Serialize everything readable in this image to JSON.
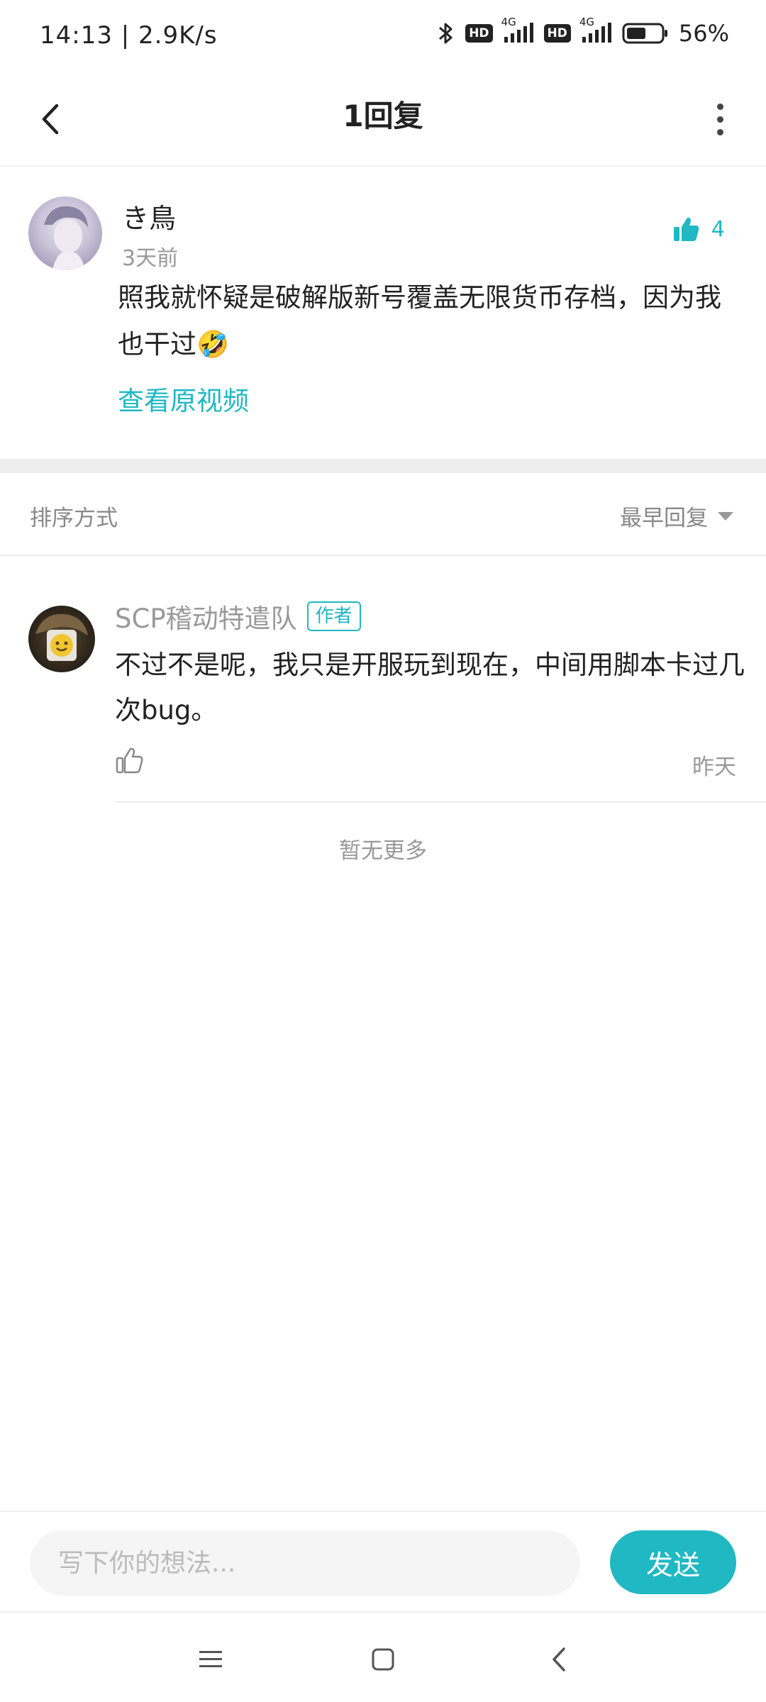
{
  "status_bar": {
    "time": "14:13 | 2.9K/s",
    "hd_1": "HD",
    "hd_2": "HD",
    "network_1": "4G",
    "network_2": "4G",
    "battery_percent": "56%",
    "battery_level": 0.56,
    "icons": [
      "bluetooth-icon",
      "signal-icon",
      "battery-icon"
    ]
  },
  "header": {
    "title": "1回复",
    "back_icon": "back-arrow-icon",
    "more_icon": "more-vertical-icon"
  },
  "main_comment": {
    "username": "き鳥",
    "time": "3天前",
    "like_count": "4",
    "content": "照我就怀疑是破解版新号覆盖无限货币存档，因为我也干过🤣",
    "link_text": "查看原视频"
  },
  "sort": {
    "label": "排序方式",
    "selected": "最早回复"
  },
  "replies": [
    {
      "username": "SCP稽动特遣队",
      "badge": "作者",
      "content": "不过不是呢，我只是开服玩到现在，中间用脚本卡过几次bug。",
      "time": "昨天"
    }
  ],
  "list_end_text": "暂无更多",
  "input": {
    "placeholder": "写下你的想法...",
    "value": "",
    "send_label": "发送"
  },
  "colors": {
    "accent": "#1fb8c3",
    "text_primary": "#222222",
    "text_secondary": "#999999"
  }
}
